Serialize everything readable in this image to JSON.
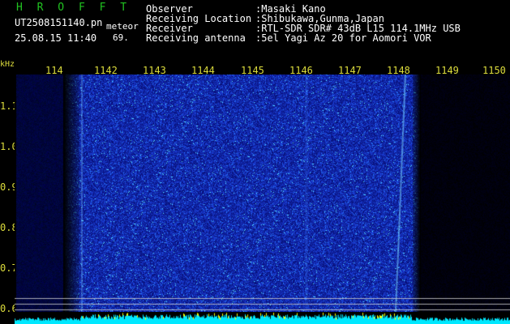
{
  "header": {
    "brand": "H R O F F T",
    "file_name": "UT2508151140.pn",
    "timestamp": "25.08.15 11:40",
    "tag_meteor": "meteor",
    "tag_value": "69.",
    "labels": {
      "observer": "Observer",
      "location": "Receiving Location",
      "receiver": "Receiver",
      "antenna": "Receiving antenna"
    },
    "values": {
      "observer": ":Masaki Kano",
      "location": ":Shibukawa,Gunma,Japan",
      "receiver": ":RTL-SDR SDR# 43dB L15 114.1MHz USB",
      "antenna": ":5el Yagi Az 20 for Aomori VOR"
    }
  },
  "spectrogram": {
    "unit_label": "kHz",
    "x_ticks": [
      "114",
      "1142",
      "1143",
      "1144",
      "1145",
      "1146",
      "1147",
      "1148",
      "1149",
      "1150"
    ],
    "y_ticks": [
      "1.1",
      "1.0",
      "0.9",
      "0.8",
      "0.7",
      "0.6"
    ]
  },
  "colors": {
    "background": "#000000",
    "brand_green": "#21c321",
    "axis_label_yellow": "#dcdc3c",
    "noise_blue": "#1f3cff",
    "noise_cyan": "#00ffff",
    "marker_yellow": "#ffff00"
  }
}
